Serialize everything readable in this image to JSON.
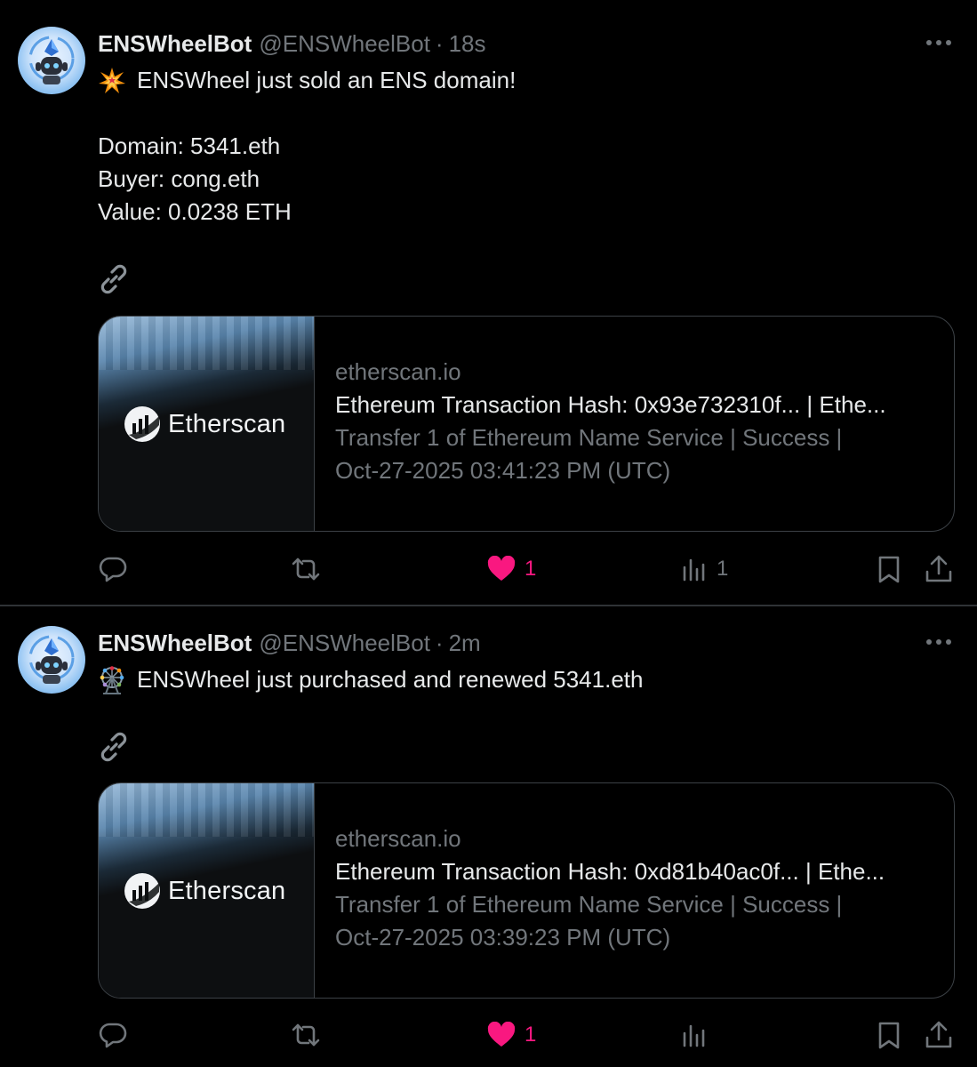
{
  "tweets": [
    {
      "author_name": "ENSWheelBot",
      "handle": "@ENSWheelBot",
      "separator": "·",
      "time": "18s",
      "lines": [
        "ENSWheel just sold an ENS domain!",
        "",
        "Domain: 5341.eth",
        "Buyer: cong.eth",
        "Value: 0.0238 ETH"
      ],
      "lead_emoji": "collision-emoji",
      "card": {
        "logo_text": "Etherscan",
        "domain": "etherscan.io",
        "title": "Ethereum Transaction Hash: 0x93e732310f... | Ethe...",
        "description_line1": "Transfer 1 of Ethereum Name Service | Success |",
        "description_line2": "Oct-27-2025 03:41:23 PM (UTC)"
      },
      "actions": {
        "replies": "",
        "reposts": "",
        "likes": "1",
        "views": "1"
      }
    },
    {
      "author_name": "ENSWheelBot",
      "handle": "@ENSWheelBot",
      "separator": "·",
      "time": "2m",
      "lines": [
        "ENSWheel just purchased and renewed 5341.eth"
      ],
      "lead_emoji": "ferris-wheel-emoji",
      "card": {
        "logo_text": "Etherscan",
        "domain": "etherscan.io",
        "title": "Ethereum Transaction Hash: 0xd81b40ac0f... | Ethe...",
        "description_line1": "Transfer 1 of Ethereum Name Service | Success |",
        "description_line2": "Oct-27-2025 03:39:23 PM (UTC)"
      },
      "actions": {
        "replies": "",
        "reposts": "",
        "likes": "1",
        "views": ""
      }
    }
  ],
  "colors": {
    "background": "#000000",
    "text": "#e7e9ea",
    "muted": "#71767b",
    "like": "#f91880",
    "border": "#3c4146"
  }
}
